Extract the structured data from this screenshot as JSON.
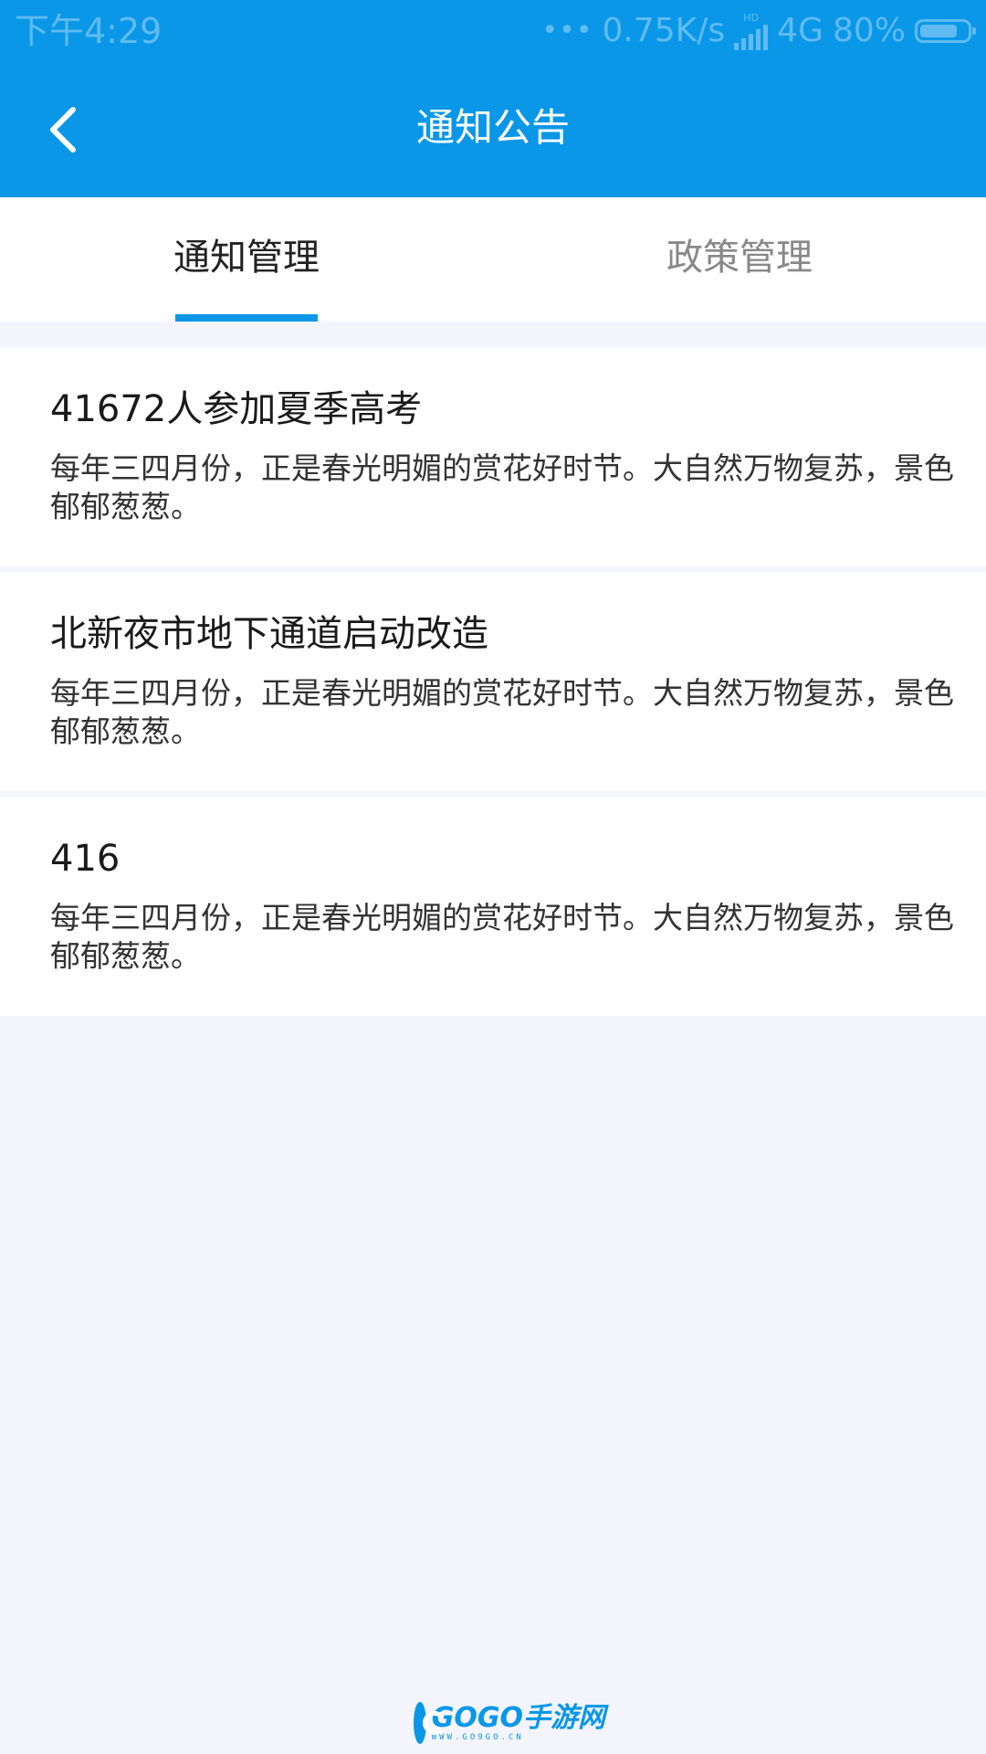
{
  "status_bar": {
    "time": "下午4:29",
    "dots": "•••",
    "network_speed": "0.75K/s",
    "hd_label": "HD",
    "network_type": "4G",
    "battery_percent": "80%",
    "battery_level": 0.8
  },
  "header": {
    "title": "通知公告",
    "back_icon": "chevron-left-icon",
    "color": "#0a97e8"
  },
  "tabs": [
    {
      "label": "通知管理",
      "active": true
    },
    {
      "label": "政策管理",
      "active": false
    }
  ],
  "notices": [
    {
      "title": "41672人参加夏季高考",
      "summary": "每年三四月份，正是春光明媚的赏花好时节。大自然万物复苏，景色郁郁葱葱。"
    },
    {
      "title": "北新夜市地下通道启动改造",
      "summary": "每年三四月份，正是春光明媚的赏花好时节。大自然万物复苏，景色郁郁葱葱。"
    },
    {
      "title": "416",
      "summary": "每年三四月份，正是春光明媚的赏花好时节。大自然万物复苏，景色郁郁葱葱。"
    }
  ],
  "watermark": {
    "main": "GOGO手游网",
    "sub": "WWW.GO9GO.CN"
  }
}
